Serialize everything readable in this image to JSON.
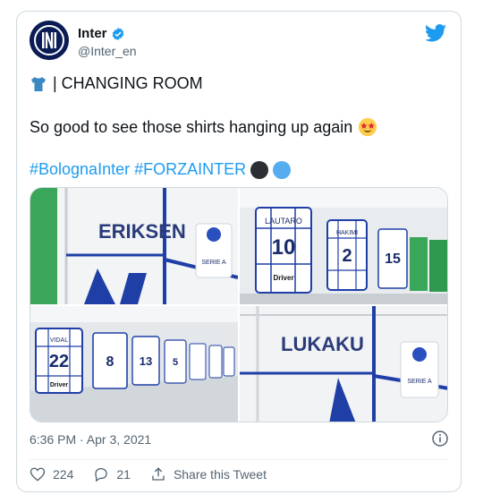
{
  "tweet": {
    "display_name": "Inter",
    "handle": "@Inter_en",
    "line1_text": "| CHANGING ROOM",
    "line2_text": "So good to see those shirts hanging up again",
    "hashtag1": "#BolognaInter",
    "hashtag2": "#FORZAINTER",
    "timestamp": "6:36 PM · Apr 3, 2021"
  },
  "photos": {
    "p1": {
      "text1": "ERIKSEN",
      "badge": "SERIE A"
    },
    "p2": {
      "name1": "LAUTARO",
      "num1": "10",
      "name2": "HAKIMI",
      "num2": "2",
      "num3": "15",
      "sponsor": "Driver"
    },
    "p3": {
      "name1": "VIDAL",
      "num1": "22",
      "num2": "8",
      "num3": "13",
      "num4": "5",
      "sponsor": "Driver"
    },
    "p4": {
      "text1": "LUKAKU",
      "badge": "SERIE A"
    }
  },
  "actions": {
    "likes": "224",
    "replies": "21",
    "share_label": "Share this Tweet"
  },
  "icons": [
    "inter-logo-icon",
    "verified-badge-icon",
    "twitter-bird-icon",
    "shirt-emoji-icon",
    "star-struck-emoji-icon",
    "info-icon",
    "heart-icon",
    "reply-icon",
    "share-icon"
  ],
  "colors": {
    "link": "#1d9bf0",
    "text": "#0f1419",
    "muted": "#536471",
    "inter_blue": "#0b1c55"
  }
}
